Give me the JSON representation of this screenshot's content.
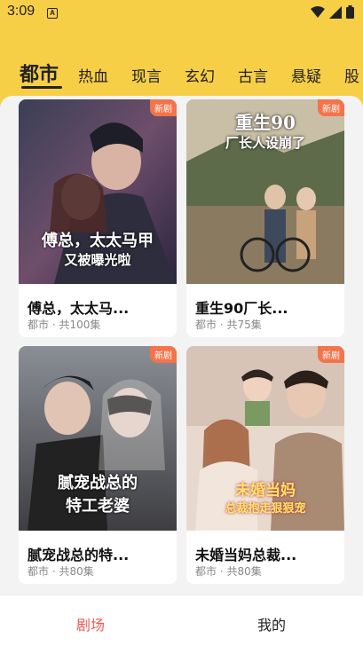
{
  "status_bar": {
    "time": "3:09",
    "notification_glyph": "A",
    "icons": [
      "wifi-icon",
      "signal-icon",
      "battery-icon"
    ]
  },
  "tabs": [
    {
      "label": "都市",
      "active": true
    },
    {
      "label": "热血",
      "active": false
    },
    {
      "label": "现言",
      "active": false
    },
    {
      "label": "玄幻",
      "active": false
    },
    {
      "label": "古言",
      "active": false
    },
    {
      "label": "悬疑",
      "active": false
    },
    {
      "label": "股",
      "active": false
    }
  ],
  "dramas": [
    {
      "badge": "新剧",
      "title": "傅总，太太马...",
      "meta": "都市 · 共100集",
      "poster_text_1": "傅总，太太马甲",
      "poster_text_2": "又被曝光啦"
    },
    {
      "badge": "新剧",
      "title": "重生90厂长...",
      "meta": "都市 · 共75集",
      "poster_text_1": "重生90",
      "poster_text_2": "厂长人设崩了"
    },
    {
      "badge": "新剧",
      "title": "腻宠战总的特...",
      "meta": "都市 · 共80集",
      "poster_text_1": "腻宠战总的",
      "poster_text_2": "特工老婆"
    },
    {
      "badge": "新剧",
      "title": "未婚当妈总裁...",
      "meta": "都市 · 共80集",
      "poster_text_1": "未婚当妈",
      "poster_text_2": "总裁抱走狠狠宠"
    }
  ],
  "bottom_nav": [
    {
      "label": "剧场",
      "active": true
    },
    {
      "label": "我的",
      "active": false
    }
  ],
  "colors": {
    "header_bg": "#f7cf47",
    "badge_bg": "#f4734a",
    "nav_active": "#ee5a4f"
  }
}
